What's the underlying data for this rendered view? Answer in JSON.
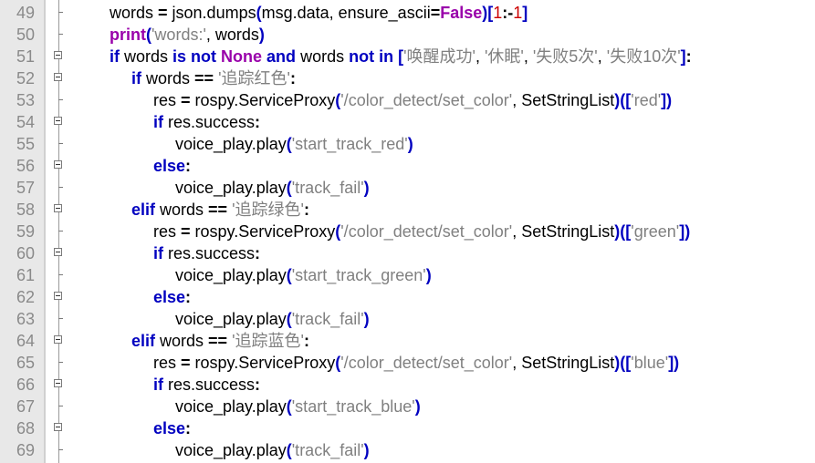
{
  "editor": {
    "lines": [
      {
        "n": "49",
        "indent": 2,
        "fold": false,
        "tokens": [
          [
            "id",
            "words "
          ],
          [
            "op",
            "="
          ],
          [
            "id",
            " json.dumps"
          ],
          [
            "br",
            "("
          ],
          [
            "id",
            "msg.data, ensure_ascii"
          ],
          [
            "op",
            "="
          ],
          [
            "bi",
            "False"
          ],
          [
            "br",
            ")["
          ],
          [
            "num",
            "1"
          ],
          [
            "op",
            ":-"
          ],
          [
            "num",
            "1"
          ],
          [
            "br",
            "]"
          ]
        ]
      },
      {
        "n": "50",
        "indent": 2,
        "fold": false,
        "tokens": [
          [
            "bi",
            "print"
          ],
          [
            "br",
            "("
          ],
          [
            "str",
            "'words:'"
          ],
          [
            "id",
            ", words"
          ],
          [
            "br",
            ")"
          ]
        ]
      },
      {
        "n": "51",
        "indent": 2,
        "fold": true,
        "tokens": [
          [
            "kw",
            "if"
          ],
          [
            "id",
            " words "
          ],
          [
            "kw",
            "is not"
          ],
          [
            "bi",
            " None"
          ],
          [
            "kw",
            " and"
          ],
          [
            "id",
            " words "
          ],
          [
            "kw",
            "not in"
          ],
          [
            "br",
            " ["
          ],
          [
            "str",
            "'唤醒成功'"
          ],
          [
            "id",
            ", "
          ],
          [
            "str",
            "'休眠'"
          ],
          [
            "id",
            ", "
          ],
          [
            "str",
            "'失败5次'"
          ],
          [
            "id",
            ", "
          ],
          [
            "str",
            "'失败10次'"
          ],
          [
            "br",
            "]"
          ],
          [
            "op",
            ":"
          ]
        ]
      },
      {
        "n": "52",
        "indent": 3,
        "fold": true,
        "tokens": [
          [
            "kw",
            "if"
          ],
          [
            "id",
            " words "
          ],
          [
            "op",
            "=="
          ],
          [
            "str",
            " '追踪红色'"
          ],
          [
            "op",
            ":"
          ]
        ]
      },
      {
        "n": "53",
        "indent": 4,
        "fold": false,
        "tokens": [
          [
            "id",
            "res "
          ],
          [
            "op",
            "="
          ],
          [
            "id",
            " rospy.ServiceProxy"
          ],
          [
            "br",
            "("
          ],
          [
            "str",
            "'/color_detect/set_color'"
          ],
          [
            "id",
            ", SetStringList"
          ],
          [
            "br",
            ")(["
          ],
          [
            "str",
            "'red'"
          ],
          [
            "br",
            "])"
          ]
        ]
      },
      {
        "n": "54",
        "indent": 4,
        "fold": true,
        "tokens": [
          [
            "kw",
            "if"
          ],
          [
            "id",
            " res.success"
          ],
          [
            "op",
            ":"
          ]
        ]
      },
      {
        "n": "55",
        "indent": 5,
        "fold": false,
        "tokens": [
          [
            "id",
            "voice_play.play"
          ],
          [
            "br",
            "("
          ],
          [
            "str",
            "'start_track_red'"
          ],
          [
            "br",
            ")"
          ]
        ]
      },
      {
        "n": "56",
        "indent": 4,
        "fold": true,
        "tokens": [
          [
            "kw",
            "else"
          ],
          [
            "op",
            ":"
          ]
        ]
      },
      {
        "n": "57",
        "indent": 5,
        "fold": false,
        "tokens": [
          [
            "id",
            "voice_play.play"
          ],
          [
            "br",
            "("
          ],
          [
            "str",
            "'track_fail'"
          ],
          [
            "br",
            ")"
          ]
        ]
      },
      {
        "n": "58",
        "indent": 3,
        "fold": true,
        "tokens": [
          [
            "kw",
            "elif"
          ],
          [
            "id",
            " words "
          ],
          [
            "op",
            "=="
          ],
          [
            "str",
            " '追踪绿色'"
          ],
          [
            "op",
            ":"
          ]
        ]
      },
      {
        "n": "59",
        "indent": 4,
        "fold": false,
        "tokens": [
          [
            "id",
            "res "
          ],
          [
            "op",
            "="
          ],
          [
            "id",
            " rospy.ServiceProxy"
          ],
          [
            "br",
            "("
          ],
          [
            "str",
            "'/color_detect/set_color'"
          ],
          [
            "id",
            ", SetStringList"
          ],
          [
            "br",
            ")(["
          ],
          [
            "str",
            "'green'"
          ],
          [
            "br",
            "])"
          ]
        ]
      },
      {
        "n": "60",
        "indent": 4,
        "fold": true,
        "tokens": [
          [
            "kw",
            "if"
          ],
          [
            "id",
            " res.success"
          ],
          [
            "op",
            ":"
          ]
        ]
      },
      {
        "n": "61",
        "indent": 5,
        "fold": false,
        "tokens": [
          [
            "id",
            "voice_play.play"
          ],
          [
            "br",
            "("
          ],
          [
            "str",
            "'start_track_green'"
          ],
          [
            "br",
            ")"
          ]
        ]
      },
      {
        "n": "62",
        "indent": 4,
        "fold": true,
        "tokens": [
          [
            "kw",
            "else"
          ],
          [
            "op",
            ":"
          ]
        ]
      },
      {
        "n": "63",
        "indent": 5,
        "fold": false,
        "tokens": [
          [
            "id",
            "voice_play.play"
          ],
          [
            "br",
            "("
          ],
          [
            "str",
            "'track_fail'"
          ],
          [
            "br",
            ")"
          ]
        ]
      },
      {
        "n": "64",
        "indent": 3,
        "fold": true,
        "tokens": [
          [
            "kw",
            "elif"
          ],
          [
            "id",
            " words "
          ],
          [
            "op",
            "=="
          ],
          [
            "str",
            " '追踪蓝色'"
          ],
          [
            "op",
            ":"
          ]
        ]
      },
      {
        "n": "65",
        "indent": 4,
        "fold": false,
        "tokens": [
          [
            "id",
            "res "
          ],
          [
            "op",
            "="
          ],
          [
            "id",
            " rospy.ServiceProxy"
          ],
          [
            "br",
            "("
          ],
          [
            "str",
            "'/color_detect/set_color'"
          ],
          [
            "id",
            ", SetStringList"
          ],
          [
            "br",
            ")(["
          ],
          [
            "str",
            "'blue'"
          ],
          [
            "br",
            "])"
          ]
        ]
      },
      {
        "n": "66",
        "indent": 4,
        "fold": true,
        "tokens": [
          [
            "kw",
            "if"
          ],
          [
            "id",
            " res.success"
          ],
          [
            "op",
            ":"
          ]
        ]
      },
      {
        "n": "67",
        "indent": 5,
        "fold": false,
        "tokens": [
          [
            "id",
            "voice_play.play"
          ],
          [
            "br",
            "("
          ],
          [
            "str",
            "'start_track_blue'"
          ],
          [
            "br",
            ")"
          ]
        ]
      },
      {
        "n": "68",
        "indent": 4,
        "fold": true,
        "tokens": [
          [
            "kw",
            "else"
          ],
          [
            "op",
            ":"
          ]
        ]
      },
      {
        "n": "69",
        "indent": 5,
        "fold": false,
        "tokens": [
          [
            "id",
            "voice_play.play"
          ],
          [
            "br",
            "("
          ],
          [
            "str",
            "'track_fail'"
          ],
          [
            "br",
            ")"
          ]
        ]
      }
    ]
  }
}
